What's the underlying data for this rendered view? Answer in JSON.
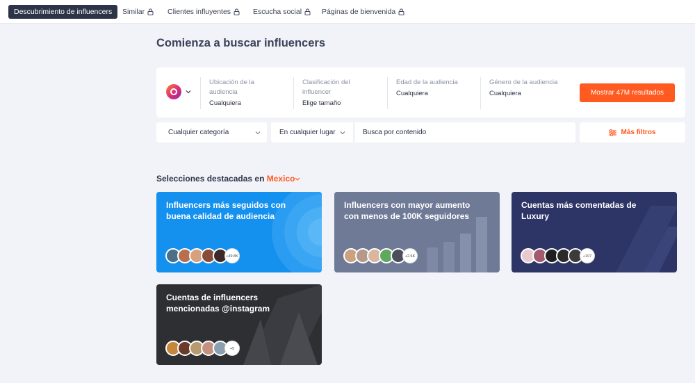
{
  "tabs": [
    {
      "label": "Descubrimiento de influencers",
      "locked": false
    },
    {
      "label": "Similar",
      "locked": true
    },
    {
      "label": "Clientes influyentes",
      "locked": true
    },
    {
      "label": "Escucha social",
      "locked": true
    },
    {
      "label": "Páginas de bienvenida",
      "locked": true
    }
  ],
  "page_title": "Comienza a buscar influencers",
  "platform_icon": "instagram-icon",
  "filters": [
    {
      "label_line1": "Ubicación de la",
      "label_line2": "audiencia",
      "value": "Cualquiera"
    },
    {
      "label_line1": "Clasificación del",
      "label_line2": "influencer",
      "value": "Elige tamaño"
    },
    {
      "label_line1": "Edad de la audiencia",
      "label_line2": "",
      "value": "Cualquiera"
    },
    {
      "label_line1": "Género de la audiencia",
      "label_line2": "",
      "value": "Cualquiera"
    }
  ],
  "show_results_label": "Mostrar 47M resultados",
  "category_select": "Cualquier categoría",
  "location_select": "En cualquier lugar",
  "content_search_placeholder": "Busca por contenido",
  "more_filters_label": "Más filtros",
  "featured": {
    "prefix": "Selecciones destacadas en ",
    "location": "Mexico"
  },
  "cards": [
    {
      "title": "Influencers más seguidos con buena calidad de audiencia",
      "count": "+49.8K",
      "bg": "#1490ef"
    },
    {
      "title": "Influencers con mayor aumento con menos de 100K seguidores",
      "count": "+2.6K",
      "bg": "#6e7a96"
    },
    {
      "title": "Cuentas más comentadas de Luxury",
      "count": "+107",
      "bg": "#2c3566"
    },
    {
      "title": "Cuentas de influencers mencionadas @instagram",
      "count": "+5",
      "bg": "#2e2f33"
    }
  ],
  "colors": {
    "accent": "#ff5a1f",
    "dark": "#2e3448"
  }
}
